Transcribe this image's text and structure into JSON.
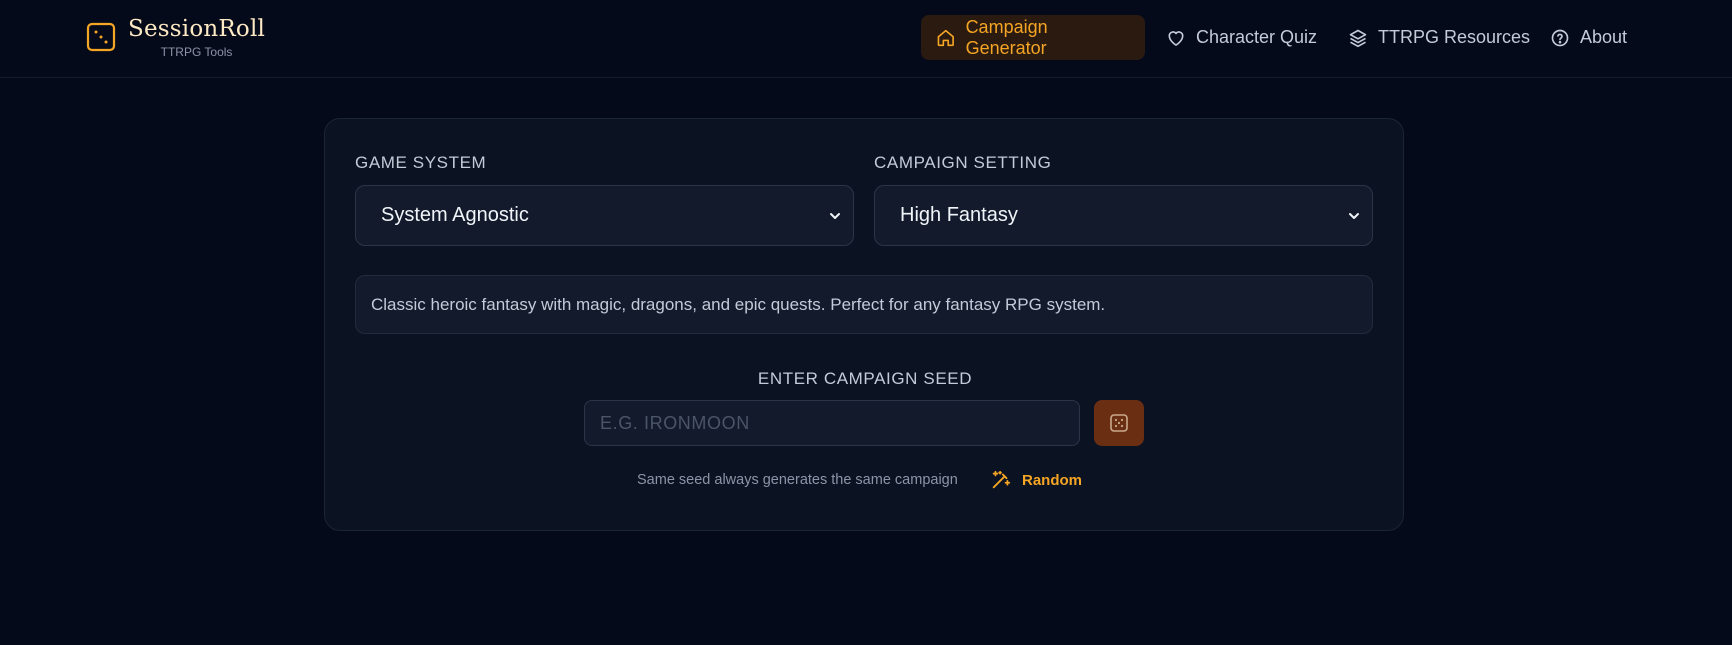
{
  "brand": {
    "title": "SessionRoll",
    "subtitle": "TTRPG Tools",
    "icon": "dice-icon"
  },
  "nav": {
    "items": [
      {
        "label": "Campaign Generator",
        "icon": "home-icon",
        "active": true
      },
      {
        "label": "Character Quiz",
        "icon": "heart-icon",
        "active": false
      },
      {
        "label": "TTRPG Resources",
        "icon": "layers-icon",
        "active": false
      },
      {
        "label": "About",
        "icon": "help-circle-icon",
        "active": false
      }
    ]
  },
  "form": {
    "game_system": {
      "label": "GAME SYSTEM",
      "value": "System Agnostic"
    },
    "campaign_setting": {
      "label": "CAMPAIGN SETTING",
      "value": "High Fantasy"
    },
    "description": "Classic heroic fantasy with magic, dragons, and epic quests. Perfect for any fantasy RPG system.",
    "seed": {
      "label": "ENTER CAMPAIGN SEED",
      "placeholder": "E.G. IRONMOON",
      "value": ""
    },
    "hint": "Same seed always generates the same campaign",
    "random_label": "Random"
  },
  "colors": {
    "background": "#050a1a",
    "card": "#0b1222",
    "accent": "#f5a524",
    "active_nav_bg": "#2a1a10",
    "dice_button_bg": "#6a2f12"
  }
}
